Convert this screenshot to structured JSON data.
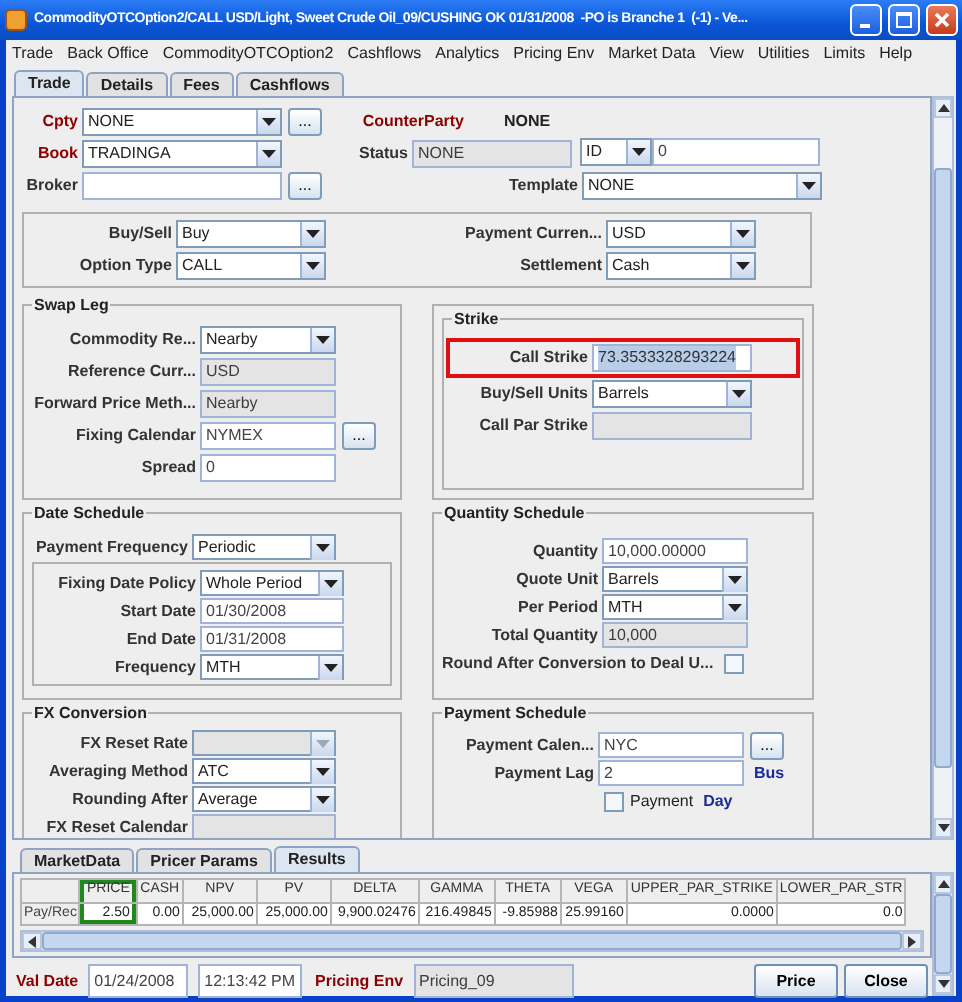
{
  "window": {
    "title": "CommodityOTCOption2/CALL USD/Light, Sweet Crude Oil_09/CUSHING OK 01/31/2008  -PO is Branche 1  (-1) - Ve..."
  },
  "menu": [
    "Trade",
    "Back Office",
    "CommodityOTCOption2",
    "Cashflows",
    "Analytics",
    "Pricing Env",
    "Market Data",
    "View",
    "Utilities",
    "Limits",
    "Help"
  ],
  "tabs": [
    {
      "label": "Trade",
      "selected": true
    },
    {
      "label": "Details",
      "selected": false
    },
    {
      "label": "Fees",
      "selected": false
    },
    {
      "label": "Cashflows",
      "selected": false
    }
  ],
  "trade_header": {
    "cpty": {
      "label": "Cpty",
      "required": true,
      "kind": "combo",
      "value": "NONE",
      "button": "..."
    },
    "counterparty": {
      "label": "CounterParty",
      "required": true,
      "kind": "display",
      "value": "NONE"
    },
    "book": {
      "label": "Book",
      "required": true,
      "kind": "combo",
      "value": "TRADINGA"
    },
    "status": {
      "label": "Status",
      "required": false,
      "kind": "text",
      "value": "NONE",
      "disabled": true
    },
    "id_type": {
      "kind": "combo",
      "value": "ID"
    },
    "id": {
      "kind": "text",
      "value": "0",
      "disabled": false
    },
    "broker": {
      "label": "Broker",
      "required": false,
      "kind": "text",
      "disabled": false,
      "button": "..."
    },
    "template": {
      "label": "Template",
      "required": false,
      "kind": "combo",
      "value": "NONE"
    }
  },
  "option_terms": {
    "left": [
      {
        "label": "Buy/Sell",
        "kind": "combo",
        "value": "Buy"
      },
      {
        "label": "Option Type",
        "kind": "combo",
        "value": "CALL"
      }
    ],
    "right": [
      {
        "label": "Payment Curren...",
        "kind": "combo",
        "value": "USD"
      },
      {
        "label": "Settlement",
        "kind": "combo",
        "value": "Cash"
      }
    ]
  },
  "swap_leg": {
    "title": "Swap Leg",
    "fields": [
      {
        "label": "Commodity Re...",
        "kind": "combo",
        "value": "Nearby",
        "disabled": false
      },
      {
        "label": "Reference Curr...",
        "kind": "text",
        "value": "USD",
        "disabled": true
      },
      {
        "label": "Forward Price Meth...",
        "kind": "text",
        "value": "Nearby",
        "disabled": true
      },
      {
        "label": "Fixing Calendar",
        "kind": "text",
        "value": "NYMEX",
        "disabled": false,
        "button": "..."
      },
      {
        "label": "Spread",
        "kind": "text",
        "value": "0",
        "disabled": false
      }
    ]
  },
  "strike": {
    "title": "Strike",
    "fields": [
      {
        "label": "Call Strike",
        "kind": "text",
        "value": "73.3533328293224",
        "disabled": false,
        "highlighted": true,
        "text_selected": true
      },
      {
        "label": "Buy/Sell Units",
        "kind": "combo",
        "value": "Barrels",
        "disabled": false
      },
      {
        "label": "Call Par Strike",
        "kind": "text",
        "disabled": true
      }
    ]
  },
  "date_schedule": {
    "title": "Date Schedule",
    "fields": [
      {
        "label": "Payment Frequency",
        "kind": "combo",
        "value": "Periodic",
        "disabled": false
      }
    ],
    "fixing": [
      {
        "label": "Fixing Date Policy",
        "kind": "combo",
        "value": "Whole Period",
        "disabled": false
      },
      {
        "label": "Start Date",
        "kind": "text",
        "value": "01/30/2008",
        "disabled": false
      },
      {
        "label": "End Date",
        "kind": "text",
        "value": "01/31/2008",
        "disabled": false
      },
      {
        "label": "Frequency",
        "kind": "combo",
        "value": "MTH",
        "disabled": false
      }
    ]
  },
  "quantity_schedule": {
    "title": "Quantity Schedule",
    "fields": [
      {
        "label": "Quantity",
        "kind": "text",
        "value": "10,000.00000",
        "disabled": false
      },
      {
        "label": "Quote Unit",
        "kind": "combo",
        "value": "Barrels",
        "disabled": false
      },
      {
        "label": "Per Period",
        "kind": "combo",
        "value": "MTH",
        "disabled": false
      },
      {
        "label": "Total Quantity",
        "kind": "text",
        "value": "10,000",
        "disabled": true
      },
      {
        "label": "Round After Conversion to Deal U...",
        "kind": "checkbox",
        "checked": false
      }
    ]
  },
  "fx_conversion": {
    "title": "FX Conversion",
    "fields": [
      {
        "label": "FX Reset Rate",
        "kind": "combo",
        "disabled": true
      },
      {
        "label": "Averaging Method",
        "kind": "combo",
        "value": "ATC",
        "disabled": false
      },
      {
        "label": "Rounding After",
        "kind": "combo",
        "value": "Average",
        "disabled": false
      },
      {
        "label": "FX Reset Calendar",
        "kind": "text",
        "disabled": true
      }
    ]
  },
  "payment_schedule": {
    "title": "Payment Schedule",
    "fields": [
      {
        "label": "Payment Calen...",
        "kind": "text",
        "value": "NYC",
        "disabled": false,
        "button": "..."
      },
      {
        "label": "Payment Lag",
        "kind": "text",
        "value": "2",
        "disabled": false,
        "suffix": "Bus"
      },
      {
        "kind": "checkbox",
        "text": "Payment",
        "checked": false,
        "suffix": "Day"
      }
    ]
  },
  "bottom_tabs": [
    {
      "label": "MarketData",
      "selected": false
    },
    {
      "label": "Pricer Params",
      "selected": false
    },
    {
      "label": "Results",
      "selected": true
    }
  ],
  "results_table": {
    "columns": [
      {
        "label": "PRICE",
        "highlighted": true
      },
      {
        "label": "CASH",
        "highlighted": false
      },
      {
        "label": "NPV",
        "highlighted": false
      },
      {
        "label": "PV",
        "highlighted": false
      },
      {
        "label": "DELTA",
        "highlighted": false
      },
      {
        "label": "GAMMA",
        "highlighted": false
      },
      {
        "label": "THETA",
        "highlighted": false
      },
      {
        "label": "VEGA",
        "highlighted": false
      },
      {
        "label": "UPPER_PAR_STRIKE",
        "highlighted": false
      },
      {
        "label": "LOWER_PAR_STR",
        "highlighted": false
      }
    ],
    "rows": [
      {
        "label": "Pay/Rec",
        "cells": [
          "2.50",
          "0.00",
          "25,000.00",
          "25,000.00",
          "9,900.02476",
          "216.49845",
          "-9.85988",
          "25.99160",
          "0.0000",
          "0.0"
        ]
      }
    ]
  },
  "footer": {
    "val_date": {
      "label": "Val Date",
      "value": "01/24/2008",
      "time": "12:13:42 PM"
    },
    "pricing_env": {
      "label": "Pricing Env",
      "value": "Pricing_09"
    },
    "buttons": [
      "Price",
      "Close"
    ]
  }
}
